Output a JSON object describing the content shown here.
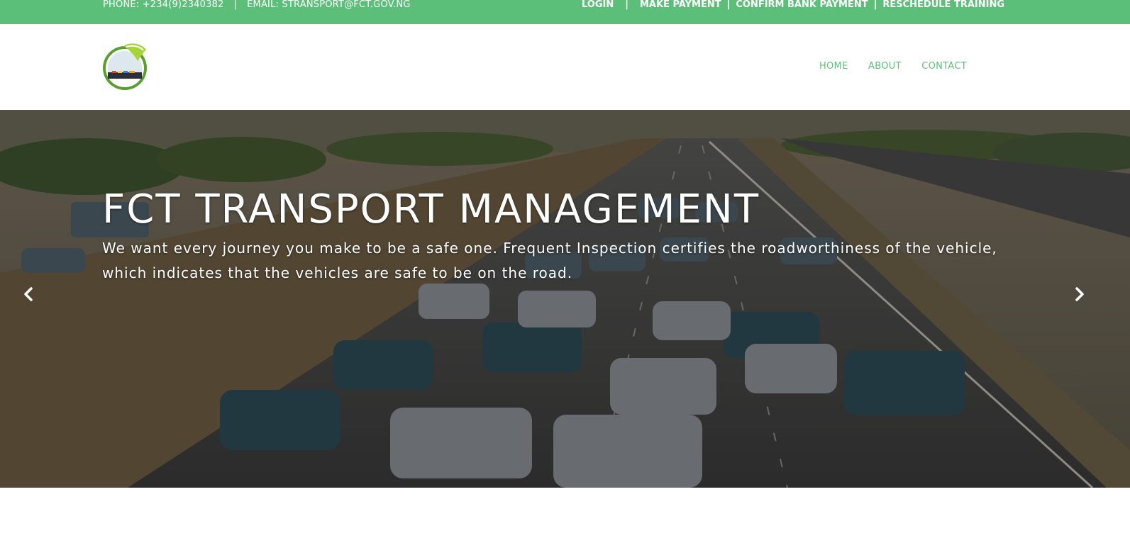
{
  "topbar": {
    "phone": "PHONE: +234(9)2340382",
    "separator": "|",
    "email": "EMAIL: STRANSPORT@FCT.GOV.NG",
    "links": {
      "login": "LOGIN",
      "make_payment": "MAKE PAYMENT",
      "confirm_bank_payment": "CONFIRM BANK PAYMENT",
      "reschedule_training": "RESCHEDULE TRAINING"
    }
  },
  "nav": {
    "home": "HOME",
    "about": "ABOUT",
    "contact": "CONTACT"
  },
  "hero": {
    "title": "FCT TRANSPORT MANAGEMENT",
    "text": "We want every journey you make to be a safe one. Frequent Inspection certifies the roadworthiness of the vehicle, which indicates that the vehicles are safe to be on the road.",
    "prev_icon": "chevron-left-icon",
    "next_icon": "chevron-right-icon"
  },
  "colors": {
    "brand_green": "#5bbf7a",
    "white": "#ffffff"
  }
}
